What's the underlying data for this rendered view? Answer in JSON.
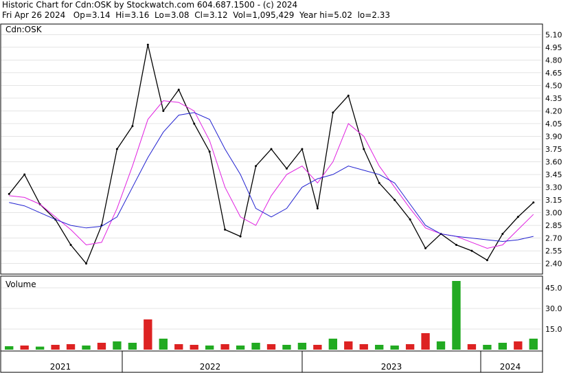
{
  "header": {
    "line1": "Historic Chart for Cdn:OSK by Stockwatch.com 604.687.1500 - (c) 2024",
    "line2": "Fri Apr 26 2024   Op=3.14  Hi=3.16  Lo=3.08  Cl=3.12  Vol=1,095,429  Year hi=5.02  lo=2.33"
  },
  "colors": {
    "price": "#000000",
    "ma_short": "#e020e0",
    "ma_long": "#2020d0",
    "vol_up": "#22aa22",
    "vol_down": "#dd2222",
    "grid": "#c8c8c8"
  },
  "chart_data": [
    {
      "type": "line",
      "title": "Cdn:OSK",
      "ylim": [
        2.3,
        5.2
      ],
      "yticks": [
        "5.10",
        "4.95",
        "4.80",
        "4.65",
        "4.50",
        "4.35",
        "4.20",
        "4.05",
        "3.90",
        "3.75",
        "3.60",
        "3.45",
        "3.30",
        "3.15",
        "3.00",
        "2.85",
        "2.70",
        "2.55",
        "2.40"
      ],
      "xlabels": [
        "2021",
        "2022",
        "2023",
        "2024"
      ],
      "x_dates": [
        "2021-06",
        "2021-07",
        "2021-08",
        "2021-09",
        "2021-10",
        "2021-11",
        "2021-12",
        "2022-01",
        "2022-02",
        "2022-03",
        "2022-04",
        "2022-05",
        "2022-06",
        "2022-07",
        "2022-08",
        "2022-09",
        "2022-10",
        "2022-11",
        "2022-12",
        "2023-01",
        "2023-02",
        "2023-03",
        "2023-04",
        "2023-05",
        "2023-06",
        "2023-07",
        "2023-08",
        "2023-09",
        "2023-10",
        "2023-11",
        "2023-12",
        "2024-01",
        "2024-02",
        "2024-03",
        "2024-04"
      ],
      "series": [
        {
          "key": "price",
          "values": [
            3.22,
            3.45,
            3.1,
            2.92,
            2.62,
            2.4,
            2.85,
            3.75,
            4.02,
            4.98,
            4.2,
            4.45,
            4.05,
            3.72,
            2.8,
            2.72,
            3.55,
            3.75,
            3.52,
            3.75,
            3.05,
            4.18,
            4.38,
            3.75,
            3.35,
            3.15,
            2.92,
            2.58,
            2.75,
            2.62,
            2.55,
            2.44,
            2.75,
            2.95,
            3.12
          ]
        },
        {
          "key": "ma_short",
          "values": [
            3.2,
            3.18,
            3.1,
            2.95,
            2.8,
            2.62,
            2.65,
            3.05,
            3.55,
            4.1,
            4.32,
            4.3,
            4.2,
            3.85,
            3.3,
            2.95,
            2.85,
            3.2,
            3.45,
            3.55,
            3.35,
            3.6,
            4.05,
            3.9,
            3.55,
            3.3,
            3.05,
            2.82,
            2.75,
            2.72,
            2.65,
            2.58,
            2.62,
            2.8,
            2.98
          ]
        },
        {
          "key": "ma_long",
          "values": [
            3.12,
            3.08,
            3.0,
            2.92,
            2.85,
            2.82,
            2.84,
            2.95,
            3.3,
            3.65,
            3.95,
            4.15,
            4.18,
            4.1,
            3.75,
            3.45,
            3.05,
            2.95,
            3.05,
            3.3,
            3.4,
            3.45,
            3.55,
            3.5,
            3.45,
            3.35,
            3.1,
            2.85,
            2.75,
            2.72,
            2.7,
            2.68,
            2.66,
            2.68,
            2.72
          ]
        }
      ]
    },
    {
      "type": "bar",
      "title": "Volume",
      "ylim": [
        0,
        52
      ],
      "yticks": [
        "45.0",
        "30.0",
        "15.0"
      ],
      "x_dates": [
        "2021-06",
        "2021-07",
        "2021-08",
        "2021-09",
        "2021-10",
        "2021-11",
        "2021-12",
        "2022-01",
        "2022-02",
        "2022-03",
        "2022-04",
        "2022-05",
        "2022-06",
        "2022-07",
        "2022-08",
        "2022-09",
        "2022-10",
        "2022-11",
        "2022-12",
        "2023-01",
        "2023-02",
        "2023-03",
        "2023-04",
        "2023-05",
        "2023-06",
        "2023-07",
        "2023-08",
        "2023-09",
        "2023-10",
        "2023-11",
        "2023-12",
        "2024-01",
        "2024-02",
        "2024-03",
        "2024-04"
      ],
      "values": [
        2.5,
        3,
        2.2,
        3.5,
        4,
        3,
        5,
        6,
        5,
        22,
        8,
        4,
        3.5,
        3,
        4,
        3,
        5,
        4,
        3.5,
        5,
        3.5,
        8,
        6,
        4,
        3.5,
        3,
        4,
        12,
        6,
        50,
        4,
        3.5,
        5,
        6,
        8
      ],
      "up": [
        true,
        false,
        true,
        false,
        false,
        true,
        false,
        true,
        true,
        false,
        true,
        false,
        false,
        true,
        false,
        true,
        true,
        false,
        true,
        true,
        false,
        true,
        false,
        false,
        true,
        true,
        false,
        false,
        true,
        true,
        false,
        true,
        true,
        false,
        true
      ]
    }
  ]
}
